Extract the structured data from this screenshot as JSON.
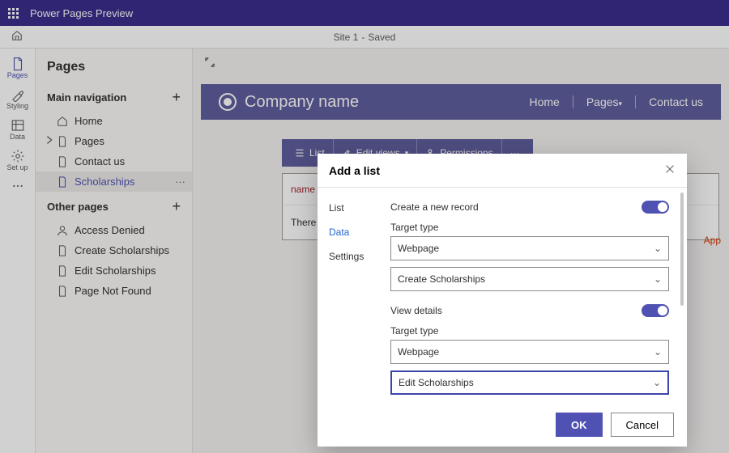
{
  "appbar": {
    "title": "Power Pages Preview"
  },
  "subbar": {
    "site": "Site 1",
    "status": "Saved"
  },
  "rail": {
    "pages": "Pages",
    "styling": "Styling",
    "data": "Data",
    "setup": "Set up"
  },
  "sidebar": {
    "title": "Pages",
    "group1": "Main navigation",
    "group2": "Other pages",
    "main": {
      "home": "Home",
      "pages": "Pages",
      "contact": "Contact us",
      "scholarships": "Scholarships"
    },
    "other": {
      "access": "Access Denied",
      "create": "Create Scholarships",
      "edit": "Edit Scholarships",
      "notfound": "Page Not Found"
    }
  },
  "siteheader": {
    "brand": "Company name",
    "nav": {
      "home": "Home",
      "pages": "Pages",
      "contact": "Contact us"
    }
  },
  "toolbar": {
    "list": "List",
    "edit": "Edit views",
    "perm": "Permissions"
  },
  "content": {
    "col1": "name",
    "row2": "There",
    "appright": "App"
  },
  "modal": {
    "title": "Add a list",
    "tabs": {
      "list": "List",
      "data": "Data",
      "settings": "Settings"
    },
    "f1": "Create a new record",
    "targetType": "Target type",
    "webpage": "Webpage",
    "createSch": "Create Scholarships",
    "viewDetails": "View details",
    "editSch": "Edit Scholarships",
    "ok": "OK",
    "cancel": "Cancel"
  }
}
